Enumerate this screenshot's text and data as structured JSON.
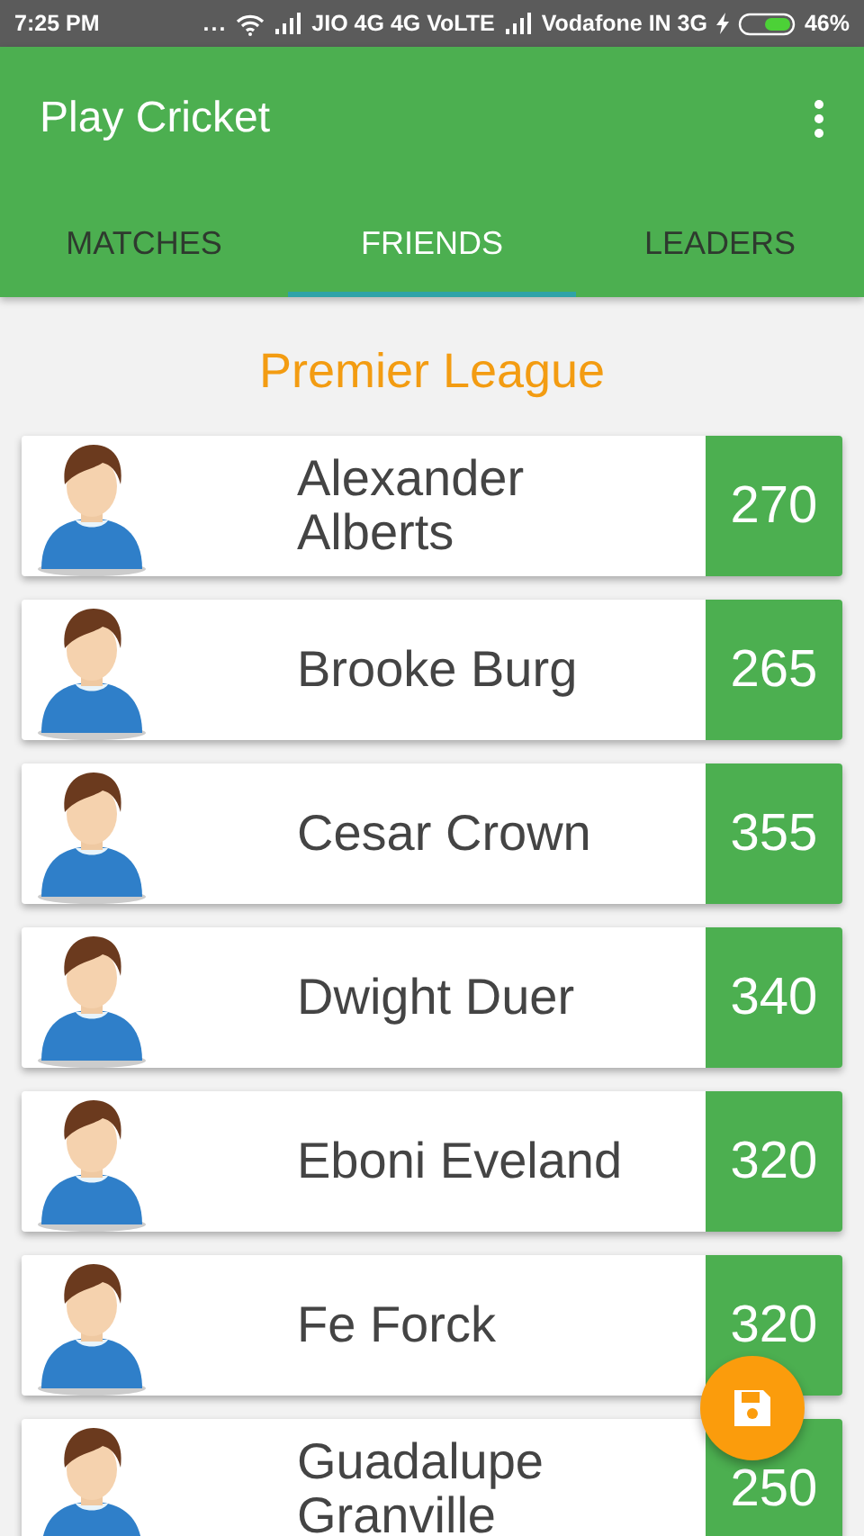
{
  "status_bar": {
    "time": "7:25 PM",
    "dots": "...",
    "carrier_1": "JIO 4G 4G VoLTE",
    "carrier_2": "Vodafone IN 3G",
    "battery": "46%"
  },
  "app_bar": {
    "title": "Play Cricket"
  },
  "tabs": [
    {
      "label": "MATCHES",
      "selected": false
    },
    {
      "label": "FRIENDS",
      "selected": true
    },
    {
      "label": "LEADERS",
      "selected": false
    }
  ],
  "league": "Premier League",
  "players": [
    {
      "name": "Alexander Alberts",
      "score": "270"
    },
    {
      "name": "Brooke Burg",
      "score": "265"
    },
    {
      "name": "Cesar Crown",
      "score": "355"
    },
    {
      "name": "Dwight Duer",
      "score": "340"
    },
    {
      "name": "Eboni Eveland",
      "score": "320"
    },
    {
      "name": "Fe Forck",
      "score": "320"
    },
    {
      "name": "Guadalupe Granville",
      "score": "250"
    }
  ]
}
